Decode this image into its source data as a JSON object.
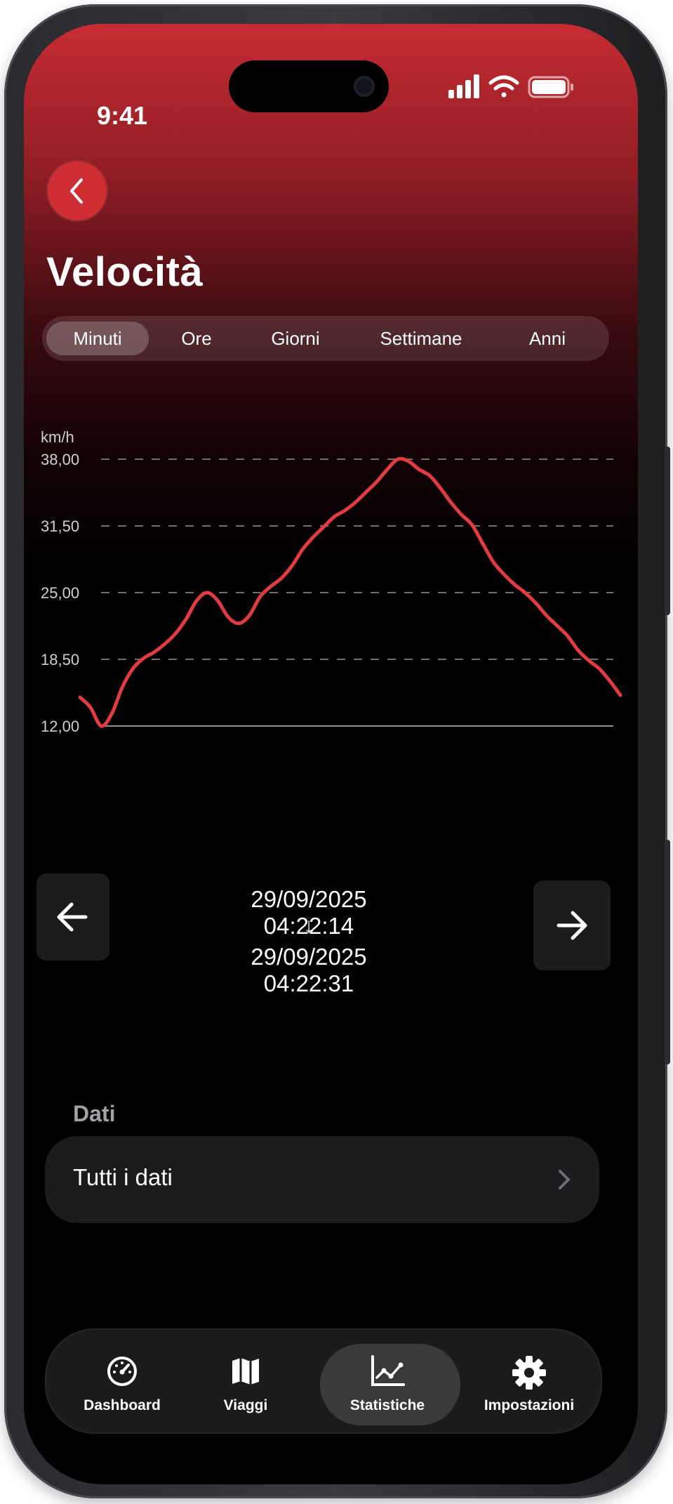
{
  "status_bar": {
    "time": "9:41"
  },
  "header": {
    "title": "Velocità"
  },
  "segments": [
    {
      "label": "Minuti",
      "active": true
    },
    {
      "label": "Ore",
      "active": false
    },
    {
      "label": "Giorni",
      "active": false
    },
    {
      "label": "Settimane",
      "active": false
    },
    {
      "label": "Anni",
      "active": false
    }
  ],
  "chart_data": {
    "type": "line",
    "ylabel": "km/h",
    "ylim": [
      12,
      38
    ],
    "y_ticks": [
      "38,00",
      "31,50",
      "25,00",
      "18,50",
      "12,00"
    ],
    "y_tick_values": [
      38,
      31.5,
      25,
      18.5,
      12
    ],
    "grid": true,
    "series": [
      {
        "color": "#e23b42",
        "values": [
          14.8,
          13.8,
          12.0,
          13.2,
          15.8,
          17.6,
          18.6,
          19.2,
          20.0,
          21.0,
          22.4,
          24.2,
          25.0,
          24.2,
          22.6,
          22.0,
          22.8,
          24.6,
          25.6,
          26.4,
          27.6,
          29.2,
          30.4,
          31.4,
          32.4,
          33.0,
          33.8,
          34.8,
          35.8,
          37.0,
          38.0,
          37.8,
          37.0,
          36.4,
          35.2,
          33.8,
          32.6,
          31.6,
          29.8,
          28.0,
          26.8,
          25.8,
          25.0,
          24.0,
          22.8,
          21.8,
          20.8,
          19.4,
          18.4,
          17.6,
          16.4,
          15.0
        ]
      }
    ]
  },
  "range": {
    "start": "29/09/2025 04:22:14",
    "separator": "↓",
    "end": "29/09/2025 04:22:31"
  },
  "data_section": {
    "label": "Dati",
    "row_label": "Tutti i dati"
  },
  "tabbar": {
    "items": [
      {
        "label": "Dashboard",
        "icon": "speedometer-icon",
        "active": false
      },
      {
        "label": "Viaggi",
        "icon": "map-icon",
        "active": false
      },
      {
        "label": "Statistiche",
        "icon": "chart-icon",
        "active": true
      },
      {
        "label": "Impostazioni",
        "icon": "gear-icon",
        "active": false
      }
    ]
  },
  "colors": {
    "accent": "#e23b42",
    "header_gradient_top": "#c62c32",
    "background": "#000000",
    "card": "#1c1c1e"
  }
}
